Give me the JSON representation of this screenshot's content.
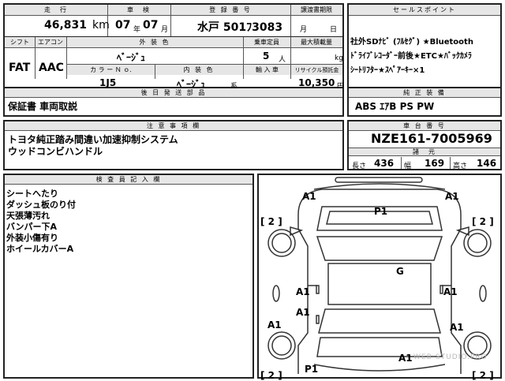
{
  "top": {
    "mileage_label": "走　行",
    "mileage_value": "46,831",
    "mileage_unit": "km",
    "inspect_label": "車　検",
    "inspect_year": "07",
    "inspect_year_unit": "年",
    "inspect_month": "07",
    "inspect_month_unit": "月",
    "reg_label": "登 録 番 号",
    "reg_value": "水戸 501ﾌ3083",
    "transfer_label": "譲渡書期限",
    "transfer_month": "月",
    "transfer_day": "日"
  },
  "row2": {
    "shift_label": "シフト",
    "shift_value": "FAT",
    "ac_label": "エアコン",
    "ac_value": "AAC",
    "ext_color_label": "外 装 色",
    "ext_color_value": "ﾍﾞｰｼﾞｭ",
    "capacity_label": "乗車定員",
    "capacity_value": "5",
    "capacity_unit": "人",
    "load_label": "最大積載量",
    "load_unit": "kg",
    "color_no_label": "カ ラ ー Ｎ ｏ.",
    "color_no_value": "1J5",
    "int_color_label": "内 装 色",
    "int_color_value": "ﾍﾞｰｼﾞｭ",
    "int_color_unit": "系",
    "import_label": "輸 入 車",
    "recycle_label": "リサイクル預託金",
    "recycle_value": "10,350",
    "recycle_unit": "円"
  },
  "docs": {
    "label": "後 日 発 送 部 品",
    "value": "保証書 車両取説"
  },
  "sales": {
    "label": "セールスポイント",
    "lines": [
      "社外SDﾅﾋﾞ (ﾌﾙｾｸﾞ) ★Bluetooth",
      "ﾄﾞﾗｲﾌﾞﾚｺｰﾀﾞｰ前後★ETC★ﾊﾞｯｸｶﾒﾗ",
      "ｼｰﾄﾘﾌﾀｰ★ｽﾍﾟｱｰｷｰ×1"
    ]
  },
  "equipment": {
    "label": "純 正 装 備",
    "value": "ABS ｴｱB PS PW"
  },
  "notes": {
    "label": "注 意 事 項 欄",
    "lines": [
      "トヨタ純正踏み間違い加速抑制システム",
      "ウッドコンビハンドル"
    ]
  },
  "chassis": {
    "label": "車 台 番 号",
    "value": "NZE161-7005969",
    "dims_label": "諸　元",
    "length_label": "長さ",
    "length_value": "436",
    "width_label": "幅",
    "width_value": "169",
    "height_label": "高さ",
    "height_value": "146"
  },
  "inspector": {
    "label": "検 査 員 記 入 欄",
    "lines": [
      "シートへたり",
      "ダッシュ板のり付",
      "天張薄汚れ",
      "バンパー下A",
      "外装小傷有り",
      "ホイールカバーA"
    ]
  },
  "diagram": {
    "marks": {
      "a1_front_left": "A1",
      "a1_front_right": "A1",
      "p1_front": "P1",
      "bracket_left_top": "[ 2 ]",
      "bracket_right_top": "[ 2 ]",
      "g_roof": "G",
      "a1_left_door": "A1",
      "a1_right_door": "A1",
      "a1_left_rear_door": "A1",
      "a1_left_side": "A1",
      "a1_right_side": "A1",
      "a1_rear": "A1",
      "p1_rear": "P1",
      "bracket_left_bottom": "[ 2 ]",
      "bracket_right_bottom": "[ 2 ]"
    },
    "watermark": "WEB-STUDIO.PRO"
  }
}
